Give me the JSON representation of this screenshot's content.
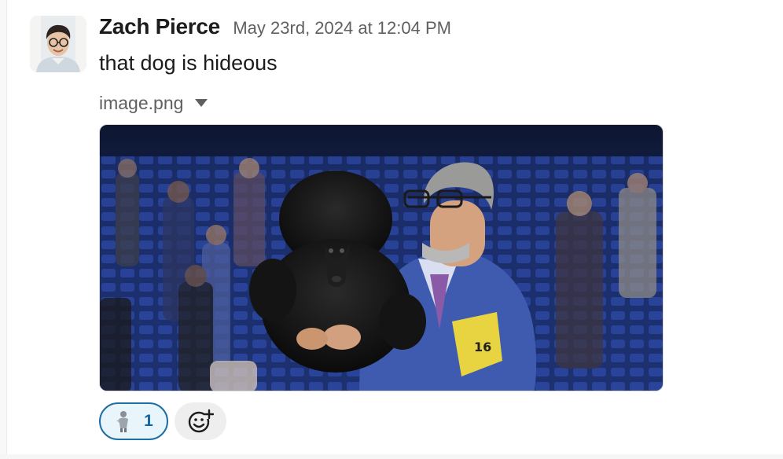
{
  "message": {
    "sender_name": "Zach Pierce",
    "timestamp": "May 23rd, 2024 at 12:04 PM",
    "text": "that dog is hideous",
    "avatar_icon": "user-avatar-photo",
    "attachment": {
      "file_name": "image.png",
      "menu_icon": "caret-down-icon",
      "image_description_icon": "photo-man-holding-black-poodle"
    },
    "reactions": [
      {
        "emoji_icon": "custom-figurine-emoji",
        "count": "1",
        "selected": true
      }
    ],
    "add_reaction_icon": "add-emoji-icon"
  },
  "colors": {
    "text_primary": "#1d1c1d",
    "text_secondary": "#616061",
    "reaction_border": "#1d6fa5",
    "reaction_bg": "#e8f5fa",
    "reaction_count": "#1264a3",
    "add_reaction_bg": "#eeeeee"
  }
}
